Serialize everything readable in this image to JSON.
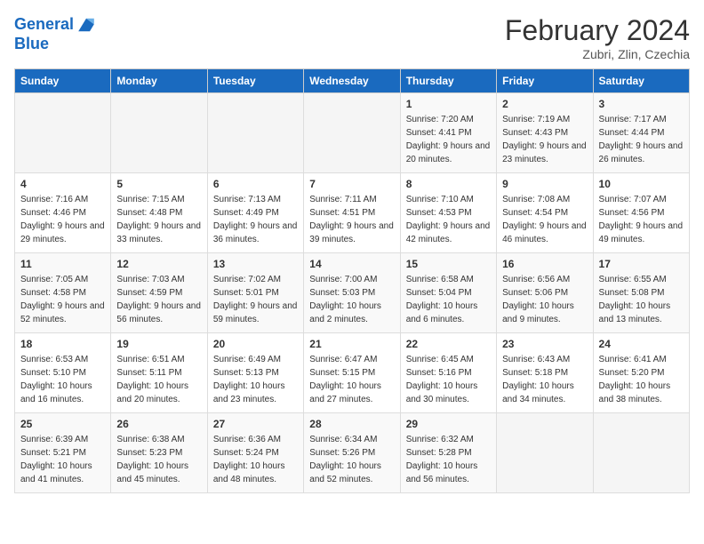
{
  "header": {
    "logo_line1": "General",
    "logo_line2": "Blue",
    "month": "February 2024",
    "location": "Zubri, Zlin, Czechia"
  },
  "weekdays": [
    "Sunday",
    "Monday",
    "Tuesday",
    "Wednesday",
    "Thursday",
    "Friday",
    "Saturday"
  ],
  "weeks": [
    [
      {
        "day": "",
        "sunrise": "",
        "sunset": "",
        "daylight": ""
      },
      {
        "day": "",
        "sunrise": "",
        "sunset": "",
        "daylight": ""
      },
      {
        "day": "",
        "sunrise": "",
        "sunset": "",
        "daylight": ""
      },
      {
        "day": "",
        "sunrise": "",
        "sunset": "",
        "daylight": ""
      },
      {
        "day": "1",
        "sunrise": "Sunrise: 7:20 AM",
        "sunset": "Sunset: 4:41 PM",
        "daylight": "Daylight: 9 hours and 20 minutes."
      },
      {
        "day": "2",
        "sunrise": "Sunrise: 7:19 AM",
        "sunset": "Sunset: 4:43 PM",
        "daylight": "Daylight: 9 hours and 23 minutes."
      },
      {
        "day": "3",
        "sunrise": "Sunrise: 7:17 AM",
        "sunset": "Sunset: 4:44 PM",
        "daylight": "Daylight: 9 hours and 26 minutes."
      }
    ],
    [
      {
        "day": "4",
        "sunrise": "Sunrise: 7:16 AM",
        "sunset": "Sunset: 4:46 PM",
        "daylight": "Daylight: 9 hours and 29 minutes."
      },
      {
        "day": "5",
        "sunrise": "Sunrise: 7:15 AM",
        "sunset": "Sunset: 4:48 PM",
        "daylight": "Daylight: 9 hours and 33 minutes."
      },
      {
        "day": "6",
        "sunrise": "Sunrise: 7:13 AM",
        "sunset": "Sunset: 4:49 PM",
        "daylight": "Daylight: 9 hours and 36 minutes."
      },
      {
        "day": "7",
        "sunrise": "Sunrise: 7:11 AM",
        "sunset": "Sunset: 4:51 PM",
        "daylight": "Daylight: 9 hours and 39 minutes."
      },
      {
        "day": "8",
        "sunrise": "Sunrise: 7:10 AM",
        "sunset": "Sunset: 4:53 PM",
        "daylight": "Daylight: 9 hours and 42 minutes."
      },
      {
        "day": "9",
        "sunrise": "Sunrise: 7:08 AM",
        "sunset": "Sunset: 4:54 PM",
        "daylight": "Daylight: 9 hours and 46 minutes."
      },
      {
        "day": "10",
        "sunrise": "Sunrise: 7:07 AM",
        "sunset": "Sunset: 4:56 PM",
        "daylight": "Daylight: 9 hours and 49 minutes."
      }
    ],
    [
      {
        "day": "11",
        "sunrise": "Sunrise: 7:05 AM",
        "sunset": "Sunset: 4:58 PM",
        "daylight": "Daylight: 9 hours and 52 minutes."
      },
      {
        "day": "12",
        "sunrise": "Sunrise: 7:03 AM",
        "sunset": "Sunset: 4:59 PM",
        "daylight": "Daylight: 9 hours and 56 minutes."
      },
      {
        "day": "13",
        "sunrise": "Sunrise: 7:02 AM",
        "sunset": "Sunset: 5:01 PM",
        "daylight": "Daylight: 9 hours and 59 minutes."
      },
      {
        "day": "14",
        "sunrise": "Sunrise: 7:00 AM",
        "sunset": "Sunset: 5:03 PM",
        "daylight": "Daylight: 10 hours and 2 minutes."
      },
      {
        "day": "15",
        "sunrise": "Sunrise: 6:58 AM",
        "sunset": "Sunset: 5:04 PM",
        "daylight": "Daylight: 10 hours and 6 minutes."
      },
      {
        "day": "16",
        "sunrise": "Sunrise: 6:56 AM",
        "sunset": "Sunset: 5:06 PM",
        "daylight": "Daylight: 10 hours and 9 minutes."
      },
      {
        "day": "17",
        "sunrise": "Sunrise: 6:55 AM",
        "sunset": "Sunset: 5:08 PM",
        "daylight": "Daylight: 10 hours and 13 minutes."
      }
    ],
    [
      {
        "day": "18",
        "sunrise": "Sunrise: 6:53 AM",
        "sunset": "Sunset: 5:10 PM",
        "daylight": "Daylight: 10 hours and 16 minutes."
      },
      {
        "day": "19",
        "sunrise": "Sunrise: 6:51 AM",
        "sunset": "Sunset: 5:11 PM",
        "daylight": "Daylight: 10 hours and 20 minutes."
      },
      {
        "day": "20",
        "sunrise": "Sunrise: 6:49 AM",
        "sunset": "Sunset: 5:13 PM",
        "daylight": "Daylight: 10 hours and 23 minutes."
      },
      {
        "day": "21",
        "sunrise": "Sunrise: 6:47 AM",
        "sunset": "Sunset: 5:15 PM",
        "daylight": "Daylight: 10 hours and 27 minutes."
      },
      {
        "day": "22",
        "sunrise": "Sunrise: 6:45 AM",
        "sunset": "Sunset: 5:16 PM",
        "daylight": "Daylight: 10 hours and 30 minutes."
      },
      {
        "day": "23",
        "sunrise": "Sunrise: 6:43 AM",
        "sunset": "Sunset: 5:18 PM",
        "daylight": "Daylight: 10 hours and 34 minutes."
      },
      {
        "day": "24",
        "sunrise": "Sunrise: 6:41 AM",
        "sunset": "Sunset: 5:20 PM",
        "daylight": "Daylight: 10 hours and 38 minutes."
      }
    ],
    [
      {
        "day": "25",
        "sunrise": "Sunrise: 6:39 AM",
        "sunset": "Sunset: 5:21 PM",
        "daylight": "Daylight: 10 hours and 41 minutes."
      },
      {
        "day": "26",
        "sunrise": "Sunrise: 6:38 AM",
        "sunset": "Sunset: 5:23 PM",
        "daylight": "Daylight: 10 hours and 45 minutes."
      },
      {
        "day": "27",
        "sunrise": "Sunrise: 6:36 AM",
        "sunset": "Sunset: 5:24 PM",
        "daylight": "Daylight: 10 hours and 48 minutes."
      },
      {
        "day": "28",
        "sunrise": "Sunrise: 6:34 AM",
        "sunset": "Sunset: 5:26 PM",
        "daylight": "Daylight: 10 hours and 52 minutes."
      },
      {
        "day": "29",
        "sunrise": "Sunrise: 6:32 AM",
        "sunset": "Sunset: 5:28 PM",
        "daylight": "Daylight: 10 hours and 56 minutes."
      },
      {
        "day": "",
        "sunrise": "",
        "sunset": "",
        "daylight": ""
      },
      {
        "day": "",
        "sunrise": "",
        "sunset": "",
        "daylight": ""
      }
    ]
  ]
}
